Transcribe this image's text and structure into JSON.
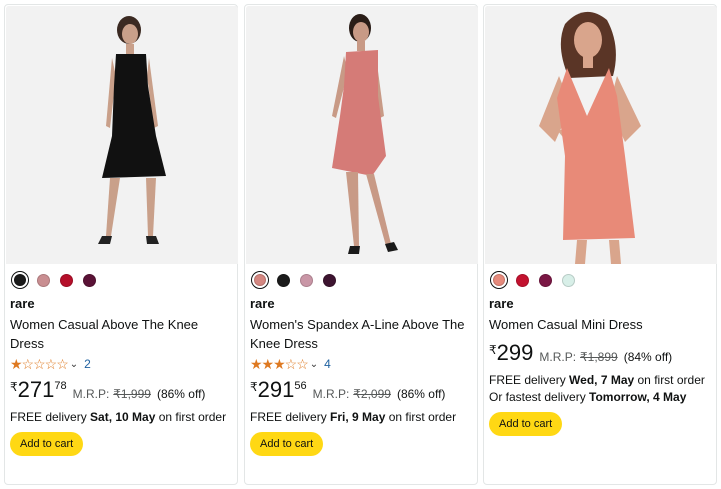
{
  "products": [
    {
      "brand": "rare",
      "title": "Women Casual Above The Knee Dress",
      "rating_stars": "★☆☆☆☆",
      "rating_count": "2",
      "currency": "₹",
      "price_whole": "271",
      "price_fraction": "78",
      "mrp_label": "M.R.P:",
      "mrp_value": "₹1,999",
      "discount": "(86% off)",
      "delivery_prefix": "FREE delivery ",
      "delivery_date": "Sat, 10 May",
      "delivery_suffix": " on first order",
      "add_to_cart": "Add to cart",
      "swatch_colors": [
        "#1b1b1b",
        "#c98e91",
        "#b50f2a",
        "#5a1236"
      ],
      "dress_color": "#111111"
    },
    {
      "brand": "rare",
      "title": "Women's Spandex A-Line Above The Knee Dress",
      "rating_stars": "★★★☆☆",
      "rating_count": "4",
      "currency": "₹",
      "price_whole": "291",
      "price_fraction": "56",
      "mrp_label": "M.R.P:",
      "mrp_value": "₹2,099",
      "discount": "(86% off)",
      "delivery_prefix": "FREE delivery ",
      "delivery_date": "Fri, 9 May",
      "delivery_suffix": " on first order",
      "add_to_cart": "Add to cart",
      "swatch_colors": [
        "#d48781",
        "#1b1b1b",
        "#c996a6",
        "#3d1430"
      ],
      "dress_color": "#d57b77"
    },
    {
      "brand": "rare",
      "title": "Women Casual Mini Dress",
      "currency": "₹",
      "price_whole": "299",
      "mrp_label": "M.R.P:",
      "mrp_value": "₹1,899",
      "discount": "(84% off)",
      "delivery_prefix": "FREE delivery ",
      "delivery_date": "Wed, 7 May",
      "delivery_suffix": " on first order",
      "fastest_prefix": "Or fastest delivery ",
      "fastest_date": "Tomorrow, 4 May",
      "add_to_cart": "Add to cart",
      "swatch_colors": [
        "#e68a7c",
        "#c3122f",
        "#7a1744",
        "#d8efe8"
      ],
      "dress_color": "#e88a78"
    }
  ],
  "colors": {
    "button_yellow": "#ffd814",
    "star_orange": "#de7921",
    "link_blue": "#2162a1"
  }
}
